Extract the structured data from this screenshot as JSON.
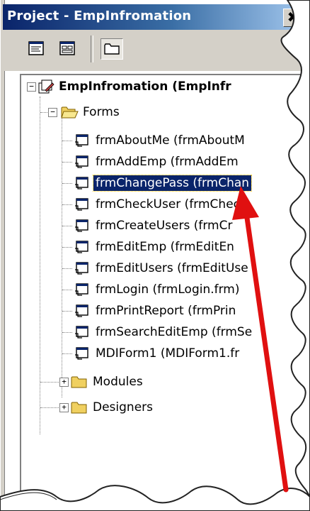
{
  "window": {
    "title": "Project - EmpInfromation",
    "close_glyph": "✖"
  },
  "toolbar": {
    "buttons": [
      {
        "name": "view-code",
        "icon": "view-code-icon"
      },
      {
        "name": "view-object",
        "icon": "view-object-icon"
      },
      {
        "name": "toggle-folders",
        "icon": "folder-icon"
      }
    ]
  },
  "tree": {
    "project": {
      "label": "EmpInfromation (EmpInfr",
      "expander": "−"
    },
    "forms_folder": {
      "label": "Forms",
      "expander": "−"
    },
    "forms": [
      {
        "label": "frmAboutMe (frmAboutM"
      },
      {
        "label": "frmAddEmp (frmAddEm"
      },
      {
        "label": "frmChangePass (frmChan",
        "selected": true
      },
      {
        "label": "frmCheckUser (frmCheck"
      },
      {
        "label": "frmCreateUsers (frmCr"
      },
      {
        "label": "frmEditEmp (frmEditEn"
      },
      {
        "label": "frmEditUsers (frmEditUse"
      },
      {
        "label": "frmLogin (frmLogin.frm)"
      },
      {
        "label": "frmPrintReport (frmPrin"
      },
      {
        "label": "frmSearchEditEmp (frmSe"
      },
      {
        "label": "MDIForm1 (MDIForm1.fr"
      }
    ],
    "modules_folder": {
      "label": "Modules",
      "expander": "+"
    },
    "designers_folder": {
      "label": "Designers",
      "expander": "+"
    }
  },
  "colors": {
    "selection": "#0a246a",
    "annotation_arrow": "#e01010",
    "folder": "#f0d060"
  }
}
